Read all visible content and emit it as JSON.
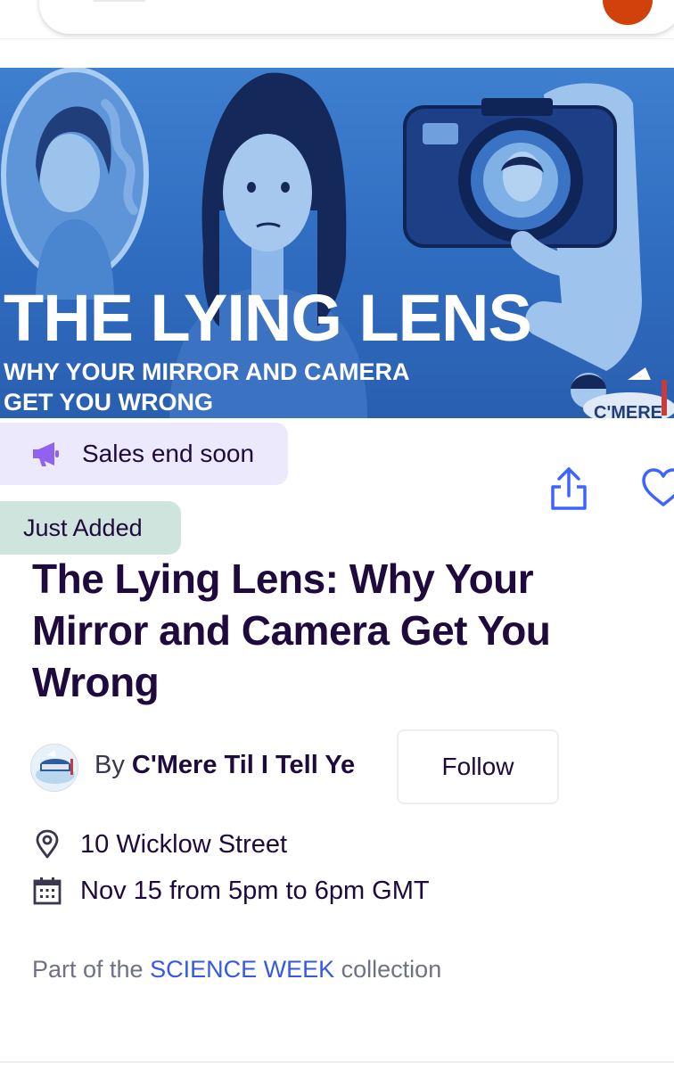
{
  "hero": {
    "title": "THE LYING  LENS",
    "subtitle_line1": "WHY YOUR MIRROR AND CAMERA",
    "subtitle_line2": "GET YOU WRONG",
    "logo_text": "C'MERE"
  },
  "badges": {
    "sales": "Sales end soon",
    "added": "Just Added"
  },
  "event": {
    "title": "The Lying Lens: Why Your Mirror and Camera Get You Wrong",
    "by_prefix": "By",
    "organizer": "C'Mere Til I Tell Ye",
    "follow_label": "Follow",
    "location": "10 Wicklow Street",
    "datetime": "Nov 15 from 5pm to 6pm GMT",
    "collection_prefix": "Part of the",
    "collection_name": "SCIENCE WEEK",
    "collection_suffix": "collection"
  },
  "icons": {
    "sales": "megaphone-icon",
    "share": "share-icon",
    "like": "heart-icon",
    "location": "map-pin-icon",
    "date": "calendar-icon"
  },
  "colors": {
    "primary_text": "#1e0a3c",
    "link": "#3659e3",
    "accent_blue": "#3d64ff",
    "sales_bg": "#ece9fc",
    "added_bg": "#cfe4dc",
    "hero_blue": "#2f6cc0"
  }
}
